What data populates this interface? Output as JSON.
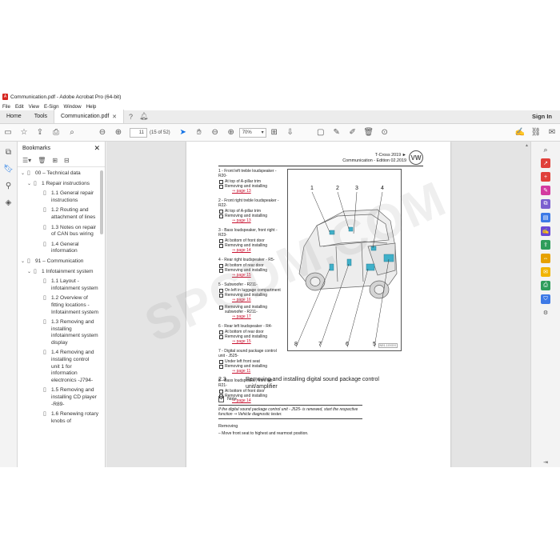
{
  "window": {
    "title": "Communication.pdf - Adobe Acrobat Pro (64-bit)",
    "pdf_badge": "A"
  },
  "menu": [
    "File",
    "Edit",
    "View",
    "E-Sign",
    "Window",
    "Help"
  ],
  "tabs": {
    "home": "Home",
    "tools": "Tools",
    "doc": "Communication.pdf",
    "signin": "Sign In"
  },
  "toolbar": {
    "page_current": "11",
    "page_count": "(15 of 52)",
    "zoom": "70%"
  },
  "bookmarks": {
    "title": "Bookmarks",
    "items": [
      {
        "level": 0,
        "expanded": true,
        "label": "00 – Technical data"
      },
      {
        "level": 1,
        "expanded": true,
        "label": "1 Repair instructions"
      },
      {
        "level": 2,
        "label": "1.1 General repair instructions"
      },
      {
        "level": 2,
        "label": "1.2 Routing and attachment of lines"
      },
      {
        "level": 2,
        "label": "1.3 Notes on repair of CAN bus wiring"
      },
      {
        "level": 2,
        "label": "1.4 General information"
      },
      {
        "level": 0,
        "expanded": true,
        "label": "91 – Communication"
      },
      {
        "level": 1,
        "expanded": true,
        "label": "1 Infotainment system"
      },
      {
        "level": 2,
        "label": "1.1 Layout - infotainment system"
      },
      {
        "level": 2,
        "label": "1.2 Overview of fitting locations - Infotainment system"
      },
      {
        "level": 2,
        "label": "1.3 Removing and installing infotainment system display"
      },
      {
        "level": 2,
        "label": "1.4 Removing and installing control unit 1 for information electronics -J794-"
      },
      {
        "level": 2,
        "label": "1.5 Removing and installing CD player -R89-"
      },
      {
        "level": 2,
        "label": "1.6 Renewing rotary knobs of"
      }
    ]
  },
  "page": {
    "header_line1": "T-Cross 2019 ►",
    "header_line2": "Communication - Edition 02.2019",
    "logo": "VW",
    "entries": [
      {
        "title": "1 - Front left treble loudspeaker - R20-",
        "subs": [
          {
            "text": "At top of A-pillar trim"
          },
          {
            "text": "Removing and installing",
            "link": "⇒ page 13"
          }
        ]
      },
      {
        "title": "2 - Front right treble loudspeaker - R22-",
        "subs": [
          {
            "text": "At top of A-pillar trim"
          },
          {
            "text": "Removing and installing",
            "link": "⇒ page 13"
          }
        ]
      },
      {
        "title": "3 - Bass loudspeaker, front right - R23-",
        "subs": [
          {
            "text": "At bottom of front door"
          },
          {
            "text": "Removing and installing",
            "link": "⇒ page 14"
          }
        ]
      },
      {
        "title": "4 - Rear right loudspeaker - R5-",
        "subs": [
          {
            "text": "At bottom of rear door"
          },
          {
            "text": "Removing and installing",
            "link": "⇒ page 15"
          }
        ]
      },
      {
        "title": "5 - Subwoofer - R211-",
        "subs": [
          {
            "text": "On left in luggage compartment"
          },
          {
            "text": "Removing and installing",
            "link": "⇒ page 16"
          },
          {
            "text": "Removing and installing subwoofer - R211-",
            "link": "⇒ page 17"
          }
        ]
      },
      {
        "title": "6 - Rear left loudspeaker - R4-",
        "subs": [
          {
            "text": "At bottom of rear door"
          },
          {
            "text": "Removing and installing",
            "link": "⇒ page 15"
          }
        ]
      },
      {
        "title": "7 - Digital sound package control unit - J525-",
        "subs": [
          {
            "text": "Under left front seat"
          },
          {
            "text": "Removing and installing",
            "link": "⇒ page 11"
          }
        ]
      },
      {
        "title": "8 - Bass loudspeaker, front left - R21-",
        "subs": [
          {
            "text": "At bottom of front door"
          },
          {
            "text": "Removing and installing",
            "link": "⇒ page 14"
          }
        ]
      }
    ],
    "figure": {
      "callouts": [
        "1",
        "2",
        "3",
        "4",
        "8",
        "7",
        "6",
        "5"
      ],
      "code": "N91-1XXXX"
    },
    "section": {
      "number": "2.3",
      "title": "Removing and installing digital sound package control unit/amplifier"
    },
    "note_label": "Note",
    "note_text": "If the digital sound package control unit - J525- is renewed, start the respective function ⇒ Vehicle diagnostic tester.",
    "removing": "Removing",
    "step": "–  Move front seat to highest and rearmost position."
  },
  "watermark": "SPCDM.COM",
  "colors": {
    "accent": "#1473e6",
    "link": "#c8102e",
    "pdf_red": "#d6241f"
  }
}
